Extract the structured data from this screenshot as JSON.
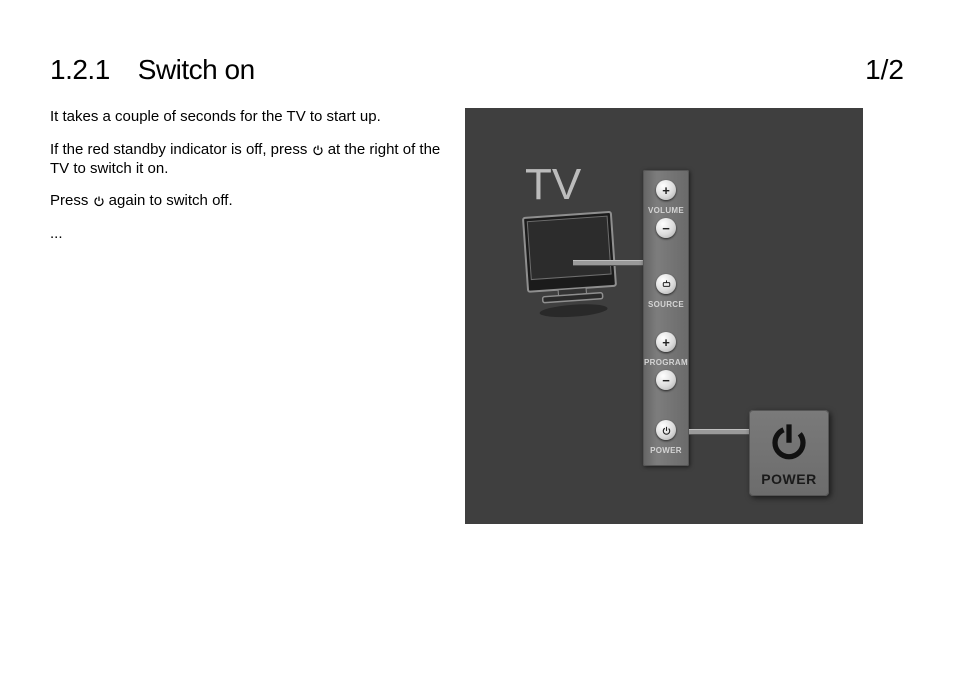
{
  "header": {
    "section_number": "1.2.1",
    "section_title": "Switch on",
    "page_indicator": "1/2"
  },
  "body": {
    "para1": "It takes a couple of seconds for the TV to start up.",
    "para2_a": "If the red standby indicator is off, press ",
    "para2_b": " at the right of the TV to switch it on.",
    "para3_a": "Press ",
    "para3_b": " again to switch off.",
    "ellipsis": "..."
  },
  "figure": {
    "tv_label": "TV",
    "panel": {
      "volume_label": "VOLUME",
      "source_label": "SOURCE",
      "program_label": "PROGRAM",
      "power_label": "POWER",
      "plus": "+",
      "minus": "−"
    },
    "big_power_label": "POWER"
  }
}
